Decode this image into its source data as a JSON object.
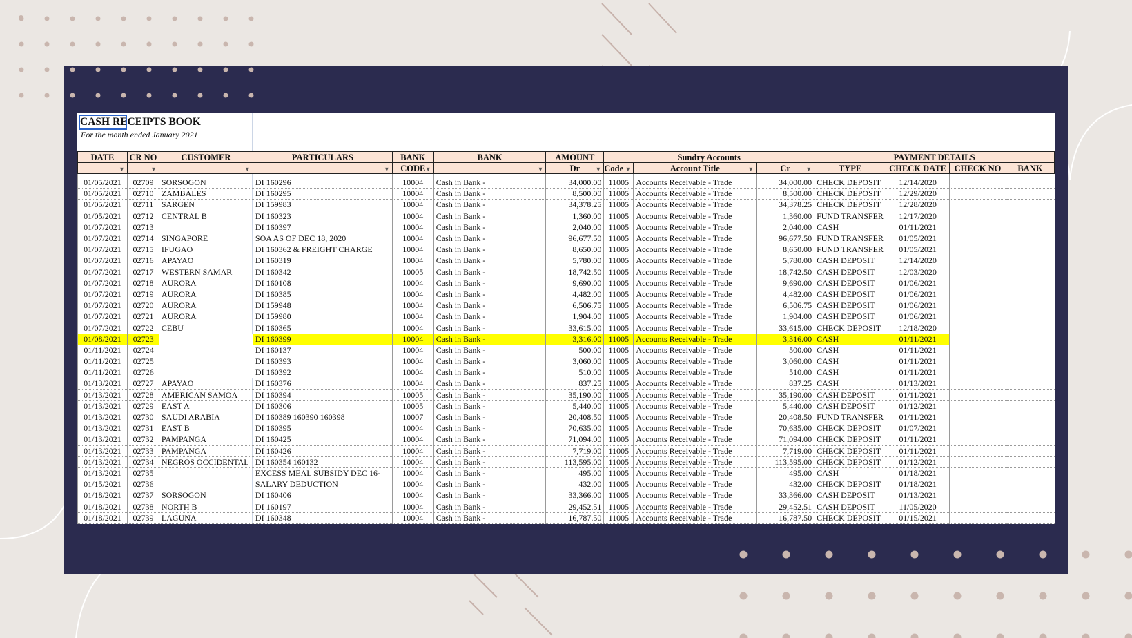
{
  "sheet": {
    "title": "CASH RECEIPTS BOOK",
    "subtitle": "For the month ended January 2021"
  },
  "group_headers": {
    "sundry": "Sundry Accounts",
    "payment": "PAYMENT DETAILS"
  },
  "headers": {
    "date": "DATE",
    "cr_no": "CR NO",
    "customer": "CUSTOMER",
    "particulars": "PARTICULARS",
    "bank_code_top": "BANK",
    "bank_code_bottom": "CODE",
    "bank": "BANK",
    "amount": "AMOUNT",
    "dr": "Dr",
    "code": "Code",
    "account_title": "Account Title",
    "cr": "Cr",
    "type": "TYPE",
    "check_date": "CHECK DATE",
    "check_no": "CHECK NO",
    "pay_bank": "BANK"
  },
  "colors": {
    "navy_frame": "#2b2b4f",
    "background": "#ebe7e3",
    "header_fill": "#fce4d6",
    "highlight": "#ffff00",
    "selection": "#2a62c9"
  },
  "rows": [
    {
      "date": "01/05/2021",
      "cr": "02709",
      "customer": "SORSOGON",
      "particulars": "DI 160296",
      "code": "10004",
      "bank": "Cash in Bank -",
      "amount": "34,000.00",
      "acode": "11005",
      "title": "Accounts Receivable - Trade",
      "credit": "34,000.00",
      "type": "CHECK DEPOSIT",
      "check_date": "12/14/2020"
    },
    {
      "date": "01/05/2021",
      "cr": "02710",
      "customer": "ZAMBALES",
      "particulars": "DI 160295",
      "code": "10004",
      "bank": "Cash in Bank -",
      "amount": "8,500.00",
      "acode": "11005",
      "title": "Accounts Receivable - Trade",
      "credit": "8,500.00",
      "type": "CHECK DEPOSIT",
      "check_date": "12/29/2020"
    },
    {
      "date": "01/05/2021",
      "cr": "02711",
      "customer": "SARGEN",
      "particulars": "DI 159983",
      "code": "10004",
      "bank": "Cash in Bank -",
      "amount": "34,378.25",
      "acode": "11005",
      "title": "Accounts Receivable - Trade",
      "credit": "34,378.25",
      "type": "CHECK DEPOSIT",
      "check_date": "12/28/2020"
    },
    {
      "date": "01/05/2021",
      "cr": "02712",
      "customer": "CENTRAL B",
      "particulars": "DI 160323",
      "code": "10004",
      "bank": "Cash in Bank -",
      "amount": "1,360.00",
      "acode": "11005",
      "title": "Accounts Receivable - Trade",
      "credit": "1,360.00",
      "type": "FUND TRANSFER",
      "check_date": "12/17/2020"
    },
    {
      "date": "01/07/2021",
      "cr": "02713",
      "customer": "",
      "particulars": "DI 160397",
      "code": "10004",
      "bank": "Cash in Bank -",
      "amount": "2,040.00",
      "acode": "11005",
      "title": "Accounts Receivable - Trade",
      "credit": "2,040.00",
      "type": "CASH",
      "check_date": "01/11/2021"
    },
    {
      "date": "01/07/2021",
      "cr": "02714",
      "customer": "SINGAPORE",
      "particulars": "SOA AS OF DEC 18, 2020",
      "code": "10004",
      "bank": "Cash in Bank -",
      "amount": "96,677.50",
      "acode": "11005",
      "title": "Accounts Receivable - Trade",
      "credit": "96,677.50",
      "type": "FUND TRANSFER",
      "check_date": "01/05/2021"
    },
    {
      "date": "01/07/2021",
      "cr": "02715",
      "customer": "IFUGAO",
      "particulars": "DI 160362 & FREIGHT CHARGE",
      "code": "10004",
      "bank": "Cash in Bank -",
      "amount": "8,650.00",
      "acode": "11005",
      "title": "Accounts Receivable - Trade",
      "credit": "8,650.00",
      "type": "FUND TRANSFER",
      "check_date": "01/05/2021"
    },
    {
      "date": "01/07/2021",
      "cr": "02716",
      "customer": "APAYAO",
      "particulars": "DI 160319",
      "code": "10004",
      "bank": "Cash in Bank -",
      "amount": "5,780.00",
      "acode": "11005",
      "title": "Accounts Receivable - Trade",
      "credit": "5,780.00",
      "type": "CASH DEPOSIT",
      "check_date": "12/14/2020"
    },
    {
      "date": "01/07/2021",
      "cr": "02717",
      "customer": "WESTERN SAMAR",
      "particulars": "DI 160342",
      "code": "10005",
      "bank": "Cash in Bank -",
      "amount": "18,742.50",
      "acode": "11005",
      "title": "Accounts Receivable - Trade",
      "credit": "18,742.50",
      "type": "CASH DEPOSIT",
      "check_date": "12/03/2020"
    },
    {
      "date": "01/07/2021",
      "cr": "02718",
      "customer": "AURORA",
      "particulars": "DI 160108",
      "code": "10004",
      "bank": "Cash in Bank -",
      "amount": "9,690.00",
      "acode": "11005",
      "title": "Accounts Receivable - Trade",
      "credit": "9,690.00",
      "type": "CASH DEPOSIT",
      "check_date": "01/06/2021"
    },
    {
      "date": "01/07/2021",
      "cr": "02719",
      "customer": "AURORA",
      "particulars": "DI 160385",
      "code": "10004",
      "bank": "Cash in Bank -",
      "amount": "4,482.00",
      "acode": "11005",
      "title": "Accounts Receivable - Trade",
      "credit": "4,482.00",
      "type": "CASH DEPOSIT",
      "check_date": "01/06/2021"
    },
    {
      "date": "01/07/2021",
      "cr": "02720",
      "customer": "AURORA",
      "particulars": "DI 159948",
      "code": "10004",
      "bank": "Cash in Bank -",
      "amount": "6,506.75",
      "acode": "11005",
      "title": "Accounts Receivable - Trade",
      "credit": "6,506.75",
      "type": "CASH DEPOSIT",
      "check_date": "01/06/2021"
    },
    {
      "date": "01/07/2021",
      "cr": "02721",
      "customer": "AURORA",
      "particulars": "DI 159980",
      "code": "10004",
      "bank": "Cash in Bank -",
      "amount": "1,904.00",
      "acode": "11005",
      "title": "Accounts Receivable - Trade",
      "credit": "1,904.00",
      "type": "CASH DEPOSIT",
      "check_date": "01/06/2021"
    },
    {
      "date": "01/07/2021",
      "cr": "02722",
      "customer": "CEBU",
      "particulars": "DI 160365",
      "code": "10004",
      "bank": "Cash in Bank -",
      "amount": "33,615.00",
      "acode": "11005",
      "title": "Accounts Receivable - Trade",
      "credit": "33,615.00",
      "type": "CHECK DEPOSIT",
      "check_date": "12/18/2020"
    },
    {
      "date": "01/08/2021",
      "cr": "02723",
      "customer": "",
      "particulars": "DI 160399",
      "code": "10004",
      "bank": "Cash in Bank -",
      "amount": "3,316.00",
      "acode": "11005",
      "title": "Accounts Receivable - Trade",
      "credit": "3,316.00",
      "type": "CASH",
      "check_date": "01/11/2021",
      "highlight": true
    },
    {
      "date": "01/11/2021",
      "cr": "02724",
      "customer": "",
      "particulars": "DI 160137",
      "code": "10004",
      "bank": "Cash in Bank -",
      "amount": "500.00",
      "acode": "11005",
      "title": "Accounts Receivable - Trade",
      "credit": "500.00",
      "type": "CASH",
      "check_date": "01/11/2021"
    },
    {
      "date": "01/11/2021",
      "cr": "02725",
      "customer": "",
      "particulars": "DI 160393",
      "code": "10004",
      "bank": "Cash in Bank -",
      "amount": "3,060.00",
      "acode": "11005",
      "title": "Accounts Receivable - Trade",
      "credit": "3,060.00",
      "type": "CASH",
      "check_date": "01/11/2021"
    },
    {
      "date": "01/11/2021",
      "cr": "02726",
      "customer": "",
      "particulars": "DI 160392",
      "code": "10004",
      "bank": "Cash in Bank -",
      "amount": "510.00",
      "acode": "11005",
      "title": "Accounts Receivable - Trade",
      "credit": "510.00",
      "type": "CASH",
      "check_date": "01/11/2021"
    },
    {
      "date": "01/13/2021",
      "cr": "02727",
      "customer": "APAYAO",
      "particulars": "DI 160376",
      "code": "10004",
      "bank": "Cash in Bank -",
      "amount": "837.25",
      "acode": "11005",
      "title": "Accounts Receivable - Trade",
      "credit": "837.25",
      "type": "CASH",
      "check_date": "01/13/2021"
    },
    {
      "date": "01/13/2021",
      "cr": "02728",
      "customer": "AMERICAN SAMOA",
      "particulars": "DI 160394",
      "code": "10005",
      "bank": "Cash in Bank -",
      "amount": "35,190.00",
      "acode": "11005",
      "title": "Accounts Receivable - Trade",
      "credit": "35,190.00",
      "type": "CASH DEPOSIT",
      "check_date": "01/11/2021"
    },
    {
      "date": "01/13/2021",
      "cr": "02729",
      "customer": "EAST A",
      "particulars": "DI 160306",
      "code": "10005",
      "bank": "Cash in Bank -",
      "amount": "5,440.00",
      "acode": "11005",
      "title": "Accounts Receivable - Trade",
      "credit": "5,440.00",
      "type": "CASH DEPOSIT",
      "check_date": "01/12/2021"
    },
    {
      "date": "01/13/2021",
      "cr": "02730",
      "customer": "SAUDI ARABIA",
      "particulars": "DI 160389 160390 160398",
      "code": "10007",
      "bank": "Cash in Bank -",
      "amount": "20,408.50",
      "acode": "11005",
      "title": "Accounts Receivable - Trade",
      "credit": "20,408.50",
      "type": "FUND TRANSFER",
      "check_date": "01/11/2021"
    },
    {
      "date": "01/13/2021",
      "cr": "02731",
      "customer": "EAST B",
      "particulars": "DI 160395",
      "code": "10004",
      "bank": "Cash in Bank -",
      "amount": "70,635.00",
      "acode": "11005",
      "title": "Accounts Receivable - Trade",
      "credit": "70,635.00",
      "type": "CHECK DEPOSIT",
      "check_date": "01/07/2021"
    },
    {
      "date": "01/13/2021",
      "cr": "02732",
      "customer": "PAMPANGA",
      "particulars": "DI 160425",
      "code": "10004",
      "bank": "Cash in Bank -",
      "amount": "71,094.00",
      "acode": "11005",
      "title": "Accounts Receivable - Trade",
      "credit": "71,094.00",
      "type": "CHECK DEPOSIT",
      "check_date": "01/11/2021"
    },
    {
      "date": "01/13/2021",
      "cr": "02733",
      "customer": "PAMPANGA",
      "particulars": "DI 160426",
      "code": "10004",
      "bank": "Cash in Bank -",
      "amount": "7,719.00",
      "acode": "11005",
      "title": "Accounts Receivable - Trade",
      "credit": "7,719.00",
      "type": "CHECK DEPOSIT",
      "check_date": "01/11/2021"
    },
    {
      "date": "01/13/2021",
      "cr": "02734",
      "customer": "NEGROS OCCIDENTAL",
      "particulars": "DI 160354 160132",
      "code": "10004",
      "bank": "Cash in Bank -",
      "amount": "113,595.00",
      "acode": "11005",
      "title": "Accounts Receivable - Trade",
      "credit": "113,595.00",
      "type": "CHECK DEPOSIT",
      "check_date": "01/12/2021"
    },
    {
      "date": "01/13/2021",
      "cr": "02735",
      "customer": "",
      "particulars": "EXCESS MEAL SUBSIDY DEC 16-",
      "code": "10004",
      "bank": "Cash in Bank -",
      "amount": "495.00",
      "acode": "11005",
      "title": "Accounts Receivable - Trade",
      "credit": "495.00",
      "type": "CASH",
      "check_date": "01/18/2021"
    },
    {
      "date": "01/15/2021",
      "cr": "02736",
      "customer": "",
      "particulars": "SALARY DEDUCTION",
      "code": "10004",
      "bank": "Cash in Bank -",
      "amount": "432.00",
      "acode": "11005",
      "title": "Accounts Receivable - Trade",
      "credit": "432.00",
      "type": "CHECK DEPOSIT",
      "check_date": "01/18/2021"
    },
    {
      "date": "01/18/2021",
      "cr": "02737",
      "customer": "SORSOGON",
      "particulars": "DI 160406",
      "code": "10004",
      "bank": "Cash in Bank -",
      "amount": "33,366.00",
      "acode": "11005",
      "title": "Accounts Receivable - Trade",
      "credit": "33,366.00",
      "type": "CASH DEPOSIT",
      "check_date": "01/13/2021"
    },
    {
      "date": "01/18/2021",
      "cr": "02738",
      "customer": "NORTH B",
      "particulars": "DI 160197",
      "code": "10004",
      "bank": "Cash in Bank -",
      "amount": "29,452.51",
      "acode": "11005",
      "title": "Accounts Receivable - Trade",
      "credit": "29,452.51",
      "type": "CASH DEPOSIT",
      "check_date": "11/05/2020"
    },
    {
      "date": "01/18/2021",
      "cr": "02739",
      "customer": "LAGUNA",
      "particulars": "DI 160348",
      "code": "10004",
      "bank": "Cash in Bank -",
      "amount": "16,787.50",
      "acode": "11005",
      "title": "Accounts Receivable - Trade",
      "credit": "16,787.50",
      "type": "CHECK DEPOSIT",
      "check_date": "01/15/2021"
    }
  ]
}
